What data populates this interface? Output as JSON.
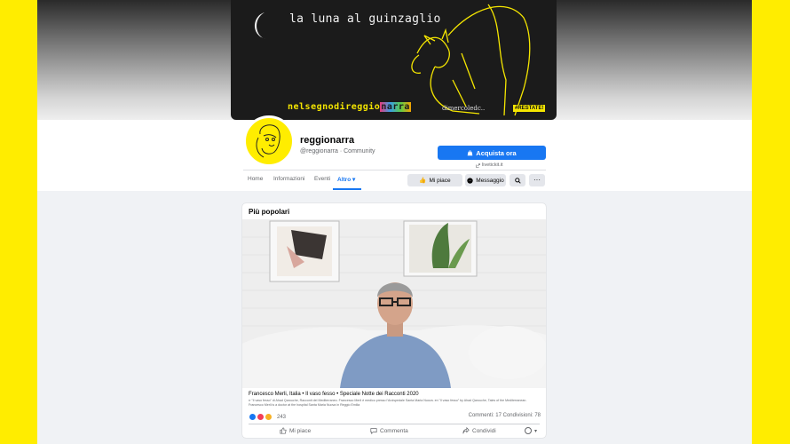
{
  "cover": {
    "title": "la luna al guinzaglio",
    "brand_prefix": "nelsegnodireggio",
    "brand_suffix": "narra",
    "tagline": "dimercoledc..",
    "badge": "#RESTATE!"
  },
  "profile": {
    "name": "reggionarra",
    "handle": "@reggionarra · Community",
    "buy_button": "Acquista ora",
    "site_link": "livetickit.it"
  },
  "nav": {
    "items": [
      "Home",
      "Informazioni",
      "Eventi",
      "Altro"
    ],
    "like_button": "Mi piace",
    "message_button": "Messaggio"
  },
  "post": {
    "section_title": "Più popolari",
    "video_title": "Francesco Merli, Italia • Il vaso fesso • Speciale Notte dei Racconti 2020",
    "description": "rr \"Il vaso fesso\" di Ahad Qarouche, Racconti del Mediterraneo. Francesco Merli è medico presso l'Arcispedale Santa Maria Nuova. en \"Il vaso fesso\" by Ahad Qarouche, Tales of the Mediterranean. Francesco Merli is a doctor at the hospital Santa Maria Nuova in Reggio Emilia",
    "reaction_count": "243",
    "counts": "Commenti: 17  Condivisioni: 78",
    "actions": [
      "Mi piace",
      "Commenta",
      "Condividi"
    ]
  },
  "colors": {
    "accent": "#1877f2",
    "brand_yellow": "#ffed00"
  }
}
